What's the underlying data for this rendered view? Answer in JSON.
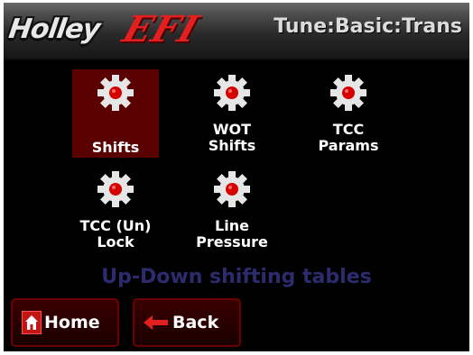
{
  "header": {
    "logo_brand": "Holley",
    "logo_product": "EFI",
    "title": "Tune:Basic:Trans"
  },
  "menu": {
    "items": [
      {
        "label": "Shifts",
        "icon": "gear-icon",
        "selected": true
      },
      {
        "label": "WOT\nShifts",
        "icon": "gear-icon",
        "selected": false
      },
      {
        "label": "TCC\nParams",
        "icon": "gear-icon",
        "selected": false
      },
      {
        "label": "TCC (Un)\nLock",
        "icon": "gear-icon",
        "selected": false
      },
      {
        "label": "Line\nPressure",
        "icon": "gear-icon",
        "selected": false
      }
    ]
  },
  "status": {
    "text": "Up-Down shifting tables"
  },
  "buttons": {
    "home_label": "Home",
    "back_label": "Back"
  },
  "colors": {
    "accent": "#e41f1f",
    "selected_bg": "#5a0000",
    "status_text": "#2b2b6e"
  }
}
